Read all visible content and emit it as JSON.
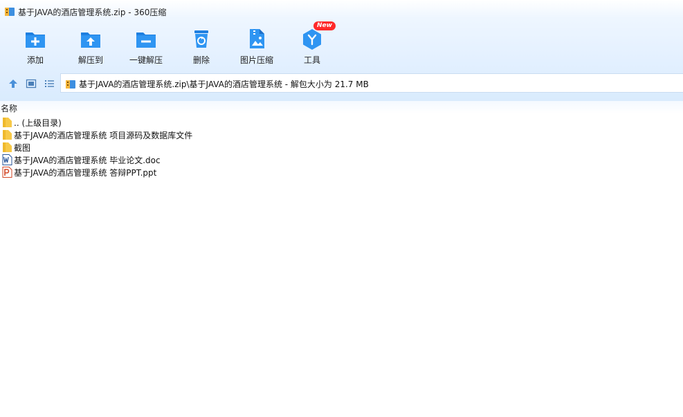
{
  "window": {
    "title": "基于JAVA的酒店管理系统.zip - 360压缩"
  },
  "toolbar": {
    "buttons": [
      {
        "label": "添加",
        "icon": "add-icon"
      },
      {
        "label": "解压到",
        "icon": "extract-to-icon"
      },
      {
        "label": "一键解压",
        "icon": "one-click-extract-icon"
      },
      {
        "label": "删除",
        "icon": "delete-icon"
      },
      {
        "label": "图片压缩",
        "icon": "image-compress-icon"
      },
      {
        "label": "工具",
        "icon": "tools-icon",
        "badge": "New"
      }
    ]
  },
  "address": {
    "path": "基于JAVA的酒店管理系统.zip\\基于JAVA的酒店管理系统 - 解包大小为 21.7 MB"
  },
  "list": {
    "column_name": "名称",
    "items": [
      {
        "name": ".. (上级目录)",
        "type": "folder"
      },
      {
        "name": "基于JAVA的酒店管理系统 项目源码及数据库文件",
        "type": "folder"
      },
      {
        "name": "截图",
        "type": "folder"
      },
      {
        "name": "基于JAVA的酒店管理系统 毕业论文.doc",
        "type": "word"
      },
      {
        "name": "基于JAVA的酒店管理系统 答辩PPT.ppt",
        "type": "ppt"
      }
    ]
  },
  "colors": {
    "accent": "#1e88e5",
    "folder": "#f7c948",
    "badge": "#ff2a2a"
  }
}
